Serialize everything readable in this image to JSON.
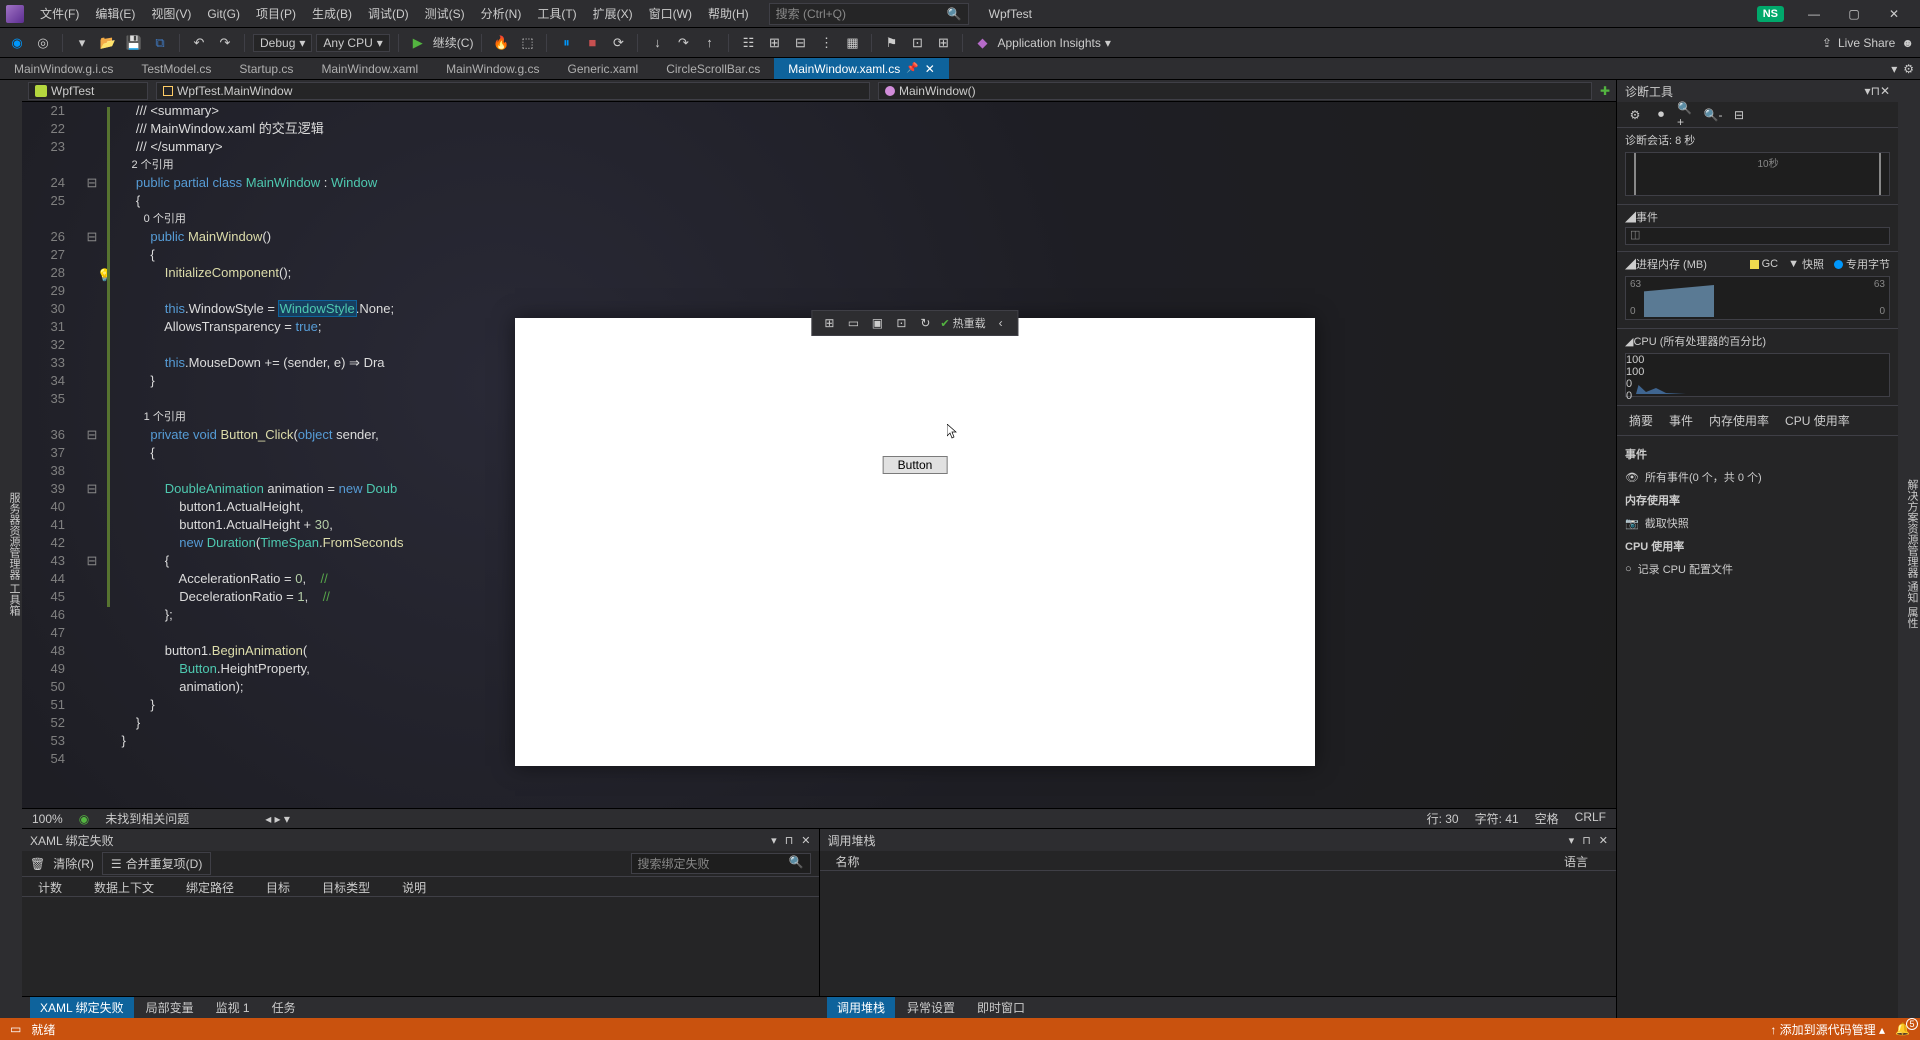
{
  "menu": {
    "file": "文件(F)",
    "edit": "编辑(E)",
    "view": "视图(V)",
    "git": "Git(G)",
    "project": "项目(P)",
    "build": "生成(B)",
    "debug": "调试(D)",
    "test": "测试(S)",
    "analyze": "分析(N)",
    "tools": "工具(T)",
    "ext": "扩展(X)",
    "window": "窗口(W)",
    "help": "帮助(H)"
  },
  "search": {
    "placeholder": "搜索 (Ctrl+Q)"
  },
  "app_title": "WpfTest",
  "user_badge": "NS",
  "toolbar": {
    "config": "Debug",
    "platform": "Any CPU",
    "start": "继续(C)",
    "app_insights": "Application Insights",
    "live_share": "Live Share"
  },
  "tabs": [
    {
      "label": "MainWindow.g.i.cs",
      "active": false
    },
    {
      "label": "TestModel.cs",
      "active": false
    },
    {
      "label": "Startup.cs",
      "active": false
    },
    {
      "label": "MainWindow.xaml",
      "active": false
    },
    {
      "label": "MainWindow.g.cs",
      "active": false
    },
    {
      "label": "Generic.xaml",
      "active": false
    },
    {
      "label": "CircleScrollBar.cs",
      "active": false
    },
    {
      "label": "MainWindow.xaml.cs",
      "active": true
    }
  ],
  "nav": {
    "project": "WpfTest",
    "class": "WpfTest.MainWindow",
    "member": "MainWindow()"
  },
  "code_lines": [
    {
      "n": 21,
      "t": "        /// <summary>",
      "cls": "cmt"
    },
    {
      "n": 22,
      "t": "        /// MainWindow.xaml 的交互逻辑",
      "cls": "cmt"
    },
    {
      "n": 23,
      "t": "        /// </summary>",
      "cls": "cmt"
    },
    {
      "n": 0,
      "t": "        2 个引用",
      "cls": "codelens"
    },
    {
      "n": 24,
      "t": "        public partial class MainWindow : Window",
      "rich": true,
      "seg": [
        [
          "        ",
          ""
        ],
        [
          "public partial class",
          "kw"
        ],
        [
          " ",
          ""
        ],
        [
          "MainWindow",
          "type"
        ],
        [
          " : ",
          ""
        ],
        [
          "Window",
          "type"
        ]
      ]
    },
    {
      "n": 25,
      "t": "        {",
      "": ""
    },
    {
      "n": 0,
      "t": "            0 个引用",
      "cls": "codelens"
    },
    {
      "n": 26,
      "t": "            public MainWindow()",
      "rich": true,
      "seg": [
        [
          "            ",
          ""
        ],
        [
          "public",
          "kw"
        ],
        [
          " ",
          ""
        ],
        [
          "MainWindow",
          "mth"
        ],
        [
          "()",
          ""
        ]
      ]
    },
    {
      "n": 27,
      "t": "            {",
      "": ""
    },
    {
      "n": 28,
      "t": "                InitializeComponent();",
      "rich": true,
      "seg": [
        [
          "                ",
          ""
        ],
        [
          "InitializeComponent",
          "mth"
        ],
        [
          "();",
          ""
        ]
      ]
    },
    {
      "n": 29,
      "t": "",
      "": ""
    },
    {
      "n": 30,
      "t": "                this.WindowStyle = WindowStyle.None;",
      "rich": true,
      "seg": [
        [
          "                ",
          ""
        ],
        [
          "this",
          "kw"
        ],
        [
          ".WindowStyle = ",
          ""
        ],
        [
          "WindowStyle",
          "type hl"
        ],
        [
          ".None;",
          ""
        ]
      ]
    },
    {
      "n": 31,
      "t": "                AllowsTransparency = true;",
      "rich": true,
      "seg": [
        [
          "                AllowsTransparency = ",
          ""
        ],
        [
          "true",
          "kw"
        ],
        [
          ";",
          ""
        ]
      ]
    },
    {
      "n": 32,
      "t": "",
      "": ""
    },
    {
      "n": 33,
      "t": "                this.MouseDown += (sender, e) ⇒ Dra",
      "rich": true,
      "seg": [
        [
          "                ",
          ""
        ],
        [
          "this",
          "kw"
        ],
        [
          ".MouseDown += (sender, e) ⇒ Dra",
          ""
        ]
      ]
    },
    {
      "n": 34,
      "t": "            }",
      "": ""
    },
    {
      "n": 35,
      "t": "",
      "": ""
    },
    {
      "n": 0,
      "t": "            1 个引用",
      "cls": "codelens"
    },
    {
      "n": 36,
      "t": "            private void Button_Click(object sender,",
      "rich": true,
      "seg": [
        [
          "            ",
          ""
        ],
        [
          "private void",
          "kw"
        ],
        [
          " ",
          ""
        ],
        [
          "Button_Click",
          "mth"
        ],
        [
          "(",
          ""
        ],
        [
          "object",
          "kw"
        ],
        [
          " sender,",
          ""
        ]
      ]
    },
    {
      "n": 37,
      "t": "            {",
      "": ""
    },
    {
      "n": 38,
      "t": "",
      "": ""
    },
    {
      "n": 39,
      "t": "                DoubleAnimation animation = new Doub",
      "rich": true,
      "seg": [
        [
          "                ",
          ""
        ],
        [
          "DoubleAnimation",
          "type"
        ],
        [
          " animation = ",
          ""
        ],
        [
          "new",
          "kw"
        ],
        [
          " ",
          ""
        ],
        [
          "Doub",
          "type"
        ]
      ]
    },
    {
      "n": 40,
      "t": "                    button1.ActualHeight,",
      "": ""
    },
    {
      "n": 41,
      "t": "                    button1.ActualHeight + 30,",
      "rich": true,
      "seg": [
        [
          "                    button1.ActualHeight + ",
          ""
        ],
        [
          "30",
          "num"
        ],
        [
          ",",
          ""
        ]
      ]
    },
    {
      "n": 42,
      "t": "                    new Duration(TimeSpan.FromSeconds",
      "rich": true,
      "seg": [
        [
          "                    ",
          ""
        ],
        [
          "new",
          "kw"
        ],
        [
          " ",
          ""
        ],
        [
          "Duration",
          "type"
        ],
        [
          "(",
          ""
        ],
        [
          "TimeSpan",
          "type"
        ],
        [
          ".",
          ""
        ],
        [
          "FromSeconds",
          "mth"
        ]
      ]
    },
    {
      "n": 43,
      "t": "                {",
      "": ""
    },
    {
      "n": 44,
      "t": "                    AccelerationRatio = 0,    //",
      "rich": true,
      "seg": [
        [
          "                    AccelerationRatio = ",
          ""
        ],
        [
          "0",
          "num"
        ],
        [
          ",    ",
          ""
        ],
        [
          "//",
          "cmt"
        ]
      ]
    },
    {
      "n": 45,
      "t": "                    DecelerationRatio = 1,    //",
      "rich": true,
      "seg": [
        [
          "                    DecelerationRatio = ",
          ""
        ],
        [
          "1",
          "num"
        ],
        [
          ",    ",
          ""
        ],
        [
          "//",
          "cmt"
        ]
      ]
    },
    {
      "n": 46,
      "t": "                };",
      "": ""
    },
    {
      "n": 47,
      "t": "",
      "": ""
    },
    {
      "n": 48,
      "t": "                button1.BeginAnimation(",
      "rich": true,
      "seg": [
        [
          "                button1.",
          ""
        ],
        [
          "BeginAnimation",
          "mth"
        ],
        [
          "(",
          ""
        ]
      ]
    },
    {
      "n": 49,
      "t": "                    Button.HeightProperty,",
      "rich": true,
      "seg": [
        [
          "                    ",
          ""
        ],
        [
          "Button",
          "type"
        ],
        [
          ".HeightProperty,",
          ""
        ]
      ]
    },
    {
      "n": 50,
      "t": "                    animation);",
      "": ""
    },
    {
      "n": 51,
      "t": "            }",
      "": ""
    },
    {
      "n": 52,
      "t": "        }",
      "": ""
    },
    {
      "n": 53,
      "t": "    }",
      "": ""
    },
    {
      "n": 54,
      "t": "",
      "": ""
    }
  ],
  "ed_status": {
    "zoom": "100%",
    "issues": "未找到相关问题",
    "line": "行: 30",
    "col": "字符: 41",
    "spaces": "空格",
    "crlf": "CRLF"
  },
  "xaml_panel": {
    "title": "XAML 绑定失败",
    "clear": "清除(R)",
    "merge": "合并重复项(D)",
    "search_ph": "搜索绑定失败",
    "cols": [
      "计数",
      "数据上下文",
      "绑定路径",
      "目标",
      "目标类型",
      "说明"
    ]
  },
  "call_panel": {
    "title": "调用堆栈",
    "col1": "名称",
    "col2": "语言"
  },
  "bottom_tabs_left": [
    "XAML 绑定失败",
    "局部变量",
    "监视 1",
    "任务"
  ],
  "bottom_tabs_right": [
    "调用堆栈",
    "异常设置",
    "即时窗口"
  ],
  "diag": {
    "title": "诊断工具",
    "session": "诊断会话: 8 秒",
    "timeline_label": "10秒",
    "events_title": "◢事件",
    "mem_title": "◢进程内存 (MB)",
    "mem_legend_gc": "GC",
    "mem_legend_snap": "快照",
    "mem_legend_priv": "专用字节",
    "mem_max": "63",
    "mem_min": "0",
    "cpu_title": "◢CPU (所有处理器的百分比)",
    "cpu_max": "100",
    "cpu_min": "0",
    "tabs": [
      "摘要",
      "事件",
      "内存使用率",
      "CPU 使用率"
    ],
    "sec_events": "事件",
    "all_events": "所有事件(0 个，共 0 个)",
    "sec_mem": "内存使用率",
    "snapshot": "截取快照",
    "sec_cpu": "CPU 使用率",
    "cpu_record": "记录 CPU 配置文件"
  },
  "left_strip": "服务器资源管理器  工具箱",
  "right_strip": "解决方案资源管理器  通知  属性",
  "statusbar": {
    "ready": "就绪",
    "src": "添加到源代码管理",
    "notif": "5"
  },
  "wpf": {
    "button": "Button",
    "hot": "热重载"
  }
}
